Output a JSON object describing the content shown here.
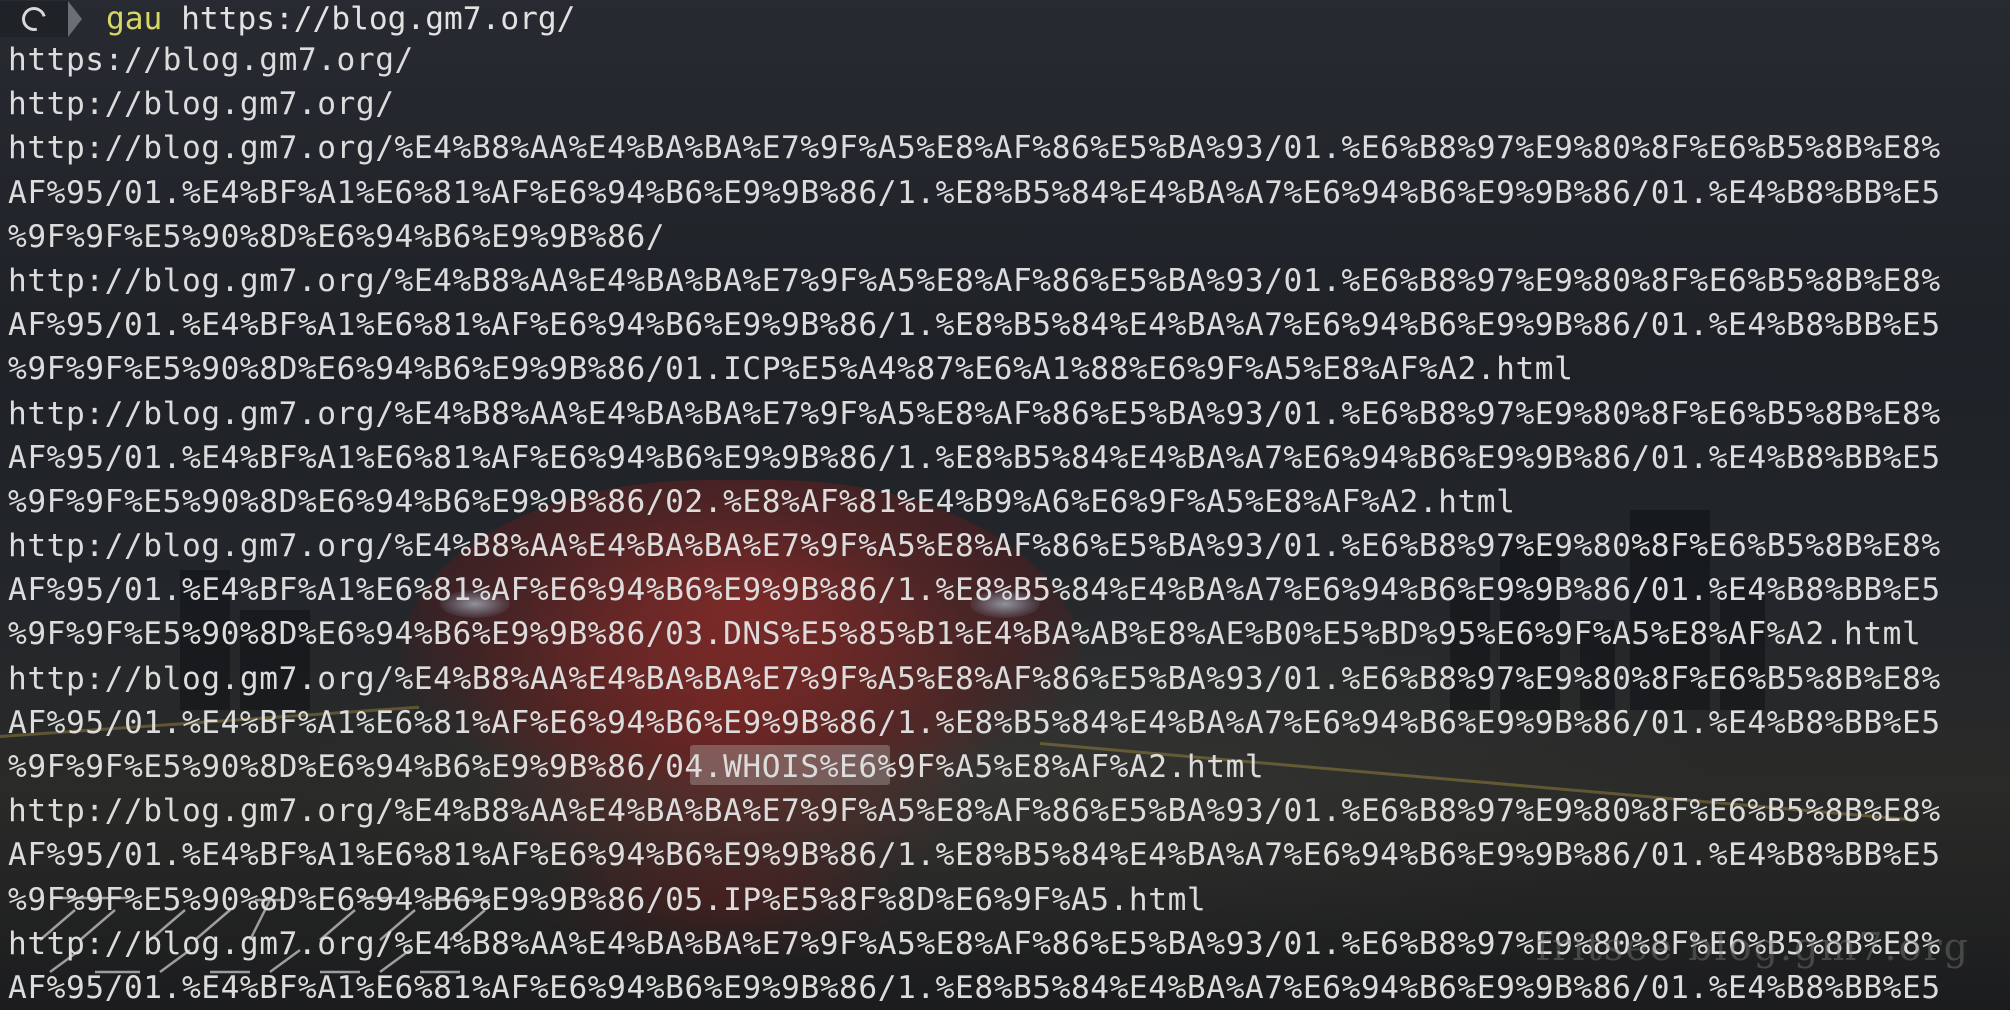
{
  "prompt": {
    "command": "gau",
    "argument": "https://blog.gm7.org/"
  },
  "output": [
    "https://blog.gm7.org/",
    "http://blog.gm7.org/",
    "http://blog.gm7.org/%E4%B8%AA%E4%BA%BA%E7%9F%A5%E8%AF%86%E5%BA%93/01.%E6%B8%97%E9%80%8F%E6%B5%8B%E8%",
    "AF%95/01.%E4%BF%A1%E6%81%AF%E6%94%B6%E9%9B%86/1.%E8%B5%84%E4%BA%A7%E6%94%B6%E9%9B%86/01.%E4%B8%BB%E5",
    "%9F%9F%E5%90%8D%E6%94%B6%E9%9B%86/",
    "http://blog.gm7.org/%E4%B8%AA%E4%BA%BA%E7%9F%A5%E8%AF%86%E5%BA%93/01.%E6%B8%97%E9%80%8F%E6%B5%8B%E8%",
    "AF%95/01.%E4%BF%A1%E6%81%AF%E6%94%B6%E9%9B%86/1.%E8%B5%84%E4%BA%A7%E6%94%B6%E9%9B%86/01.%E4%B8%BB%E5",
    "%9F%9F%E5%90%8D%E6%94%B6%E9%9B%86/01.ICP%E5%A4%87%E6%A1%88%E6%9F%A5%E8%AF%A2.html",
    "http://blog.gm7.org/%E4%B8%AA%E4%BA%BA%E7%9F%A5%E8%AF%86%E5%BA%93/01.%E6%B8%97%E9%80%8F%E6%B5%8B%E8%",
    "AF%95/01.%E4%BF%A1%E6%81%AF%E6%94%B6%E9%9B%86/1.%E8%B5%84%E4%BA%A7%E6%94%B6%E9%9B%86/01.%E4%B8%BB%E5",
    "%9F%9F%E5%90%8D%E6%94%B6%E9%9B%86/02.%E8%AF%81%E4%B9%A6%E6%9F%A5%E8%AF%A2.html",
    "http://blog.gm7.org/%E4%B8%AA%E4%BA%BA%E7%9F%A5%E8%AF%86%E5%BA%93/01.%E6%B8%97%E9%80%8F%E6%B5%8B%E8%",
    "AF%95/01.%E4%BF%A1%E6%81%AF%E6%94%B6%E9%9B%86/1.%E8%B5%84%E4%BA%A7%E6%94%B6%E9%9B%86/01.%E4%B8%BB%E5",
    "%9F%9F%E5%90%8D%E6%94%B6%E9%9B%86/03.DNS%E5%85%B1%E4%BA%AB%E8%AE%B0%E5%BD%95%E6%9F%A5%E8%AF%A2.html",
    "http://blog.gm7.org/%E4%B8%AA%E4%BA%BA%E7%9F%A5%E8%AF%86%E5%BA%93/01.%E6%B8%97%E9%80%8F%E6%B5%8B%E8%",
    "AF%95/01.%E4%BF%A1%E6%81%AF%E6%94%B6%E9%9B%86/1.%E8%B5%84%E4%BA%A7%E6%94%B6%E9%9B%86/01.%E4%B8%BB%E5",
    "%9F%9F%E5%90%8D%E6%94%B6%E9%9B%86/04.WHOIS%E6%9F%A5%E8%AF%A2.html",
    "http://blog.gm7.org/%E4%B8%AA%E4%BA%BA%E7%9F%A5%E8%AF%86%E5%BA%93/01.%E6%B8%97%E9%80%8F%E6%B5%8B%E8%",
    "AF%95/01.%E4%BF%A1%E6%81%AF%E6%94%B6%E9%9B%86/1.%E8%B5%84%E4%BA%A7%E6%94%B6%E9%9B%86/01.%E4%B8%BB%E5",
    "%9F%9F%E5%90%8D%E6%94%B6%E9%9B%86/05.IP%E5%8F%8D%E6%9F%A5.html",
    "http://blog.gm7.org/%E4%B8%AA%E4%BA%BA%E7%9F%A5%E8%AF%86%E5%BA%93/01.%E6%B8%97%E9%80%8F%E6%B5%8B%E8%",
    "AF%95/01.%E4%BF%A1%E6%81%AF%E6%94%B6%E9%9B%86/1.%E8%B5%84%E4%BA%A7%E6%94%B6%E9%9B%86/01.%E4%B8%BB%E5"
  ],
  "watermark": "fritsee blog.gm7.org",
  "icons": {
    "prompt_os": "debian-swirl-icon",
    "prompt_separator": "powerline-arrow-icon"
  },
  "colors": {
    "command": "#d7d765",
    "text": "#dcdcdc",
    "background": "#1e2227"
  }
}
